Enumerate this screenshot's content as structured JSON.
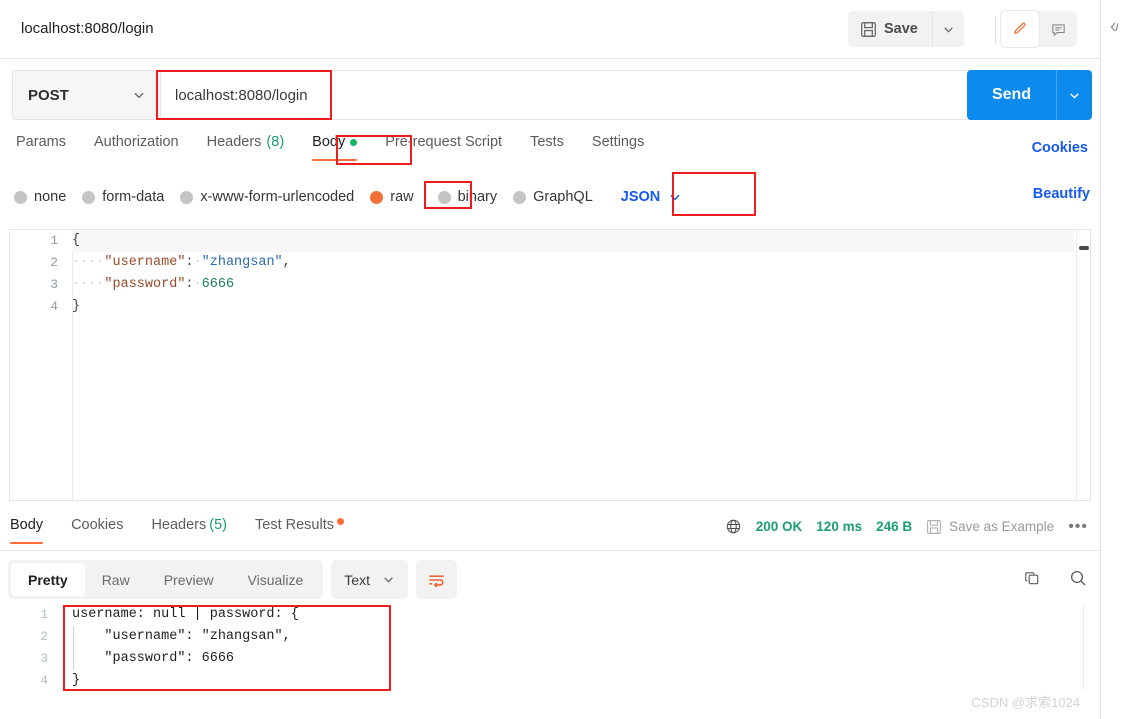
{
  "header": {
    "request_title": "localhost:8080/login",
    "save_label": "Save",
    "save_icon": "floppy-disk-icon",
    "save_caret_icon": "chevron-down-icon",
    "edit_icon": "pencil-icon",
    "comment_icon": "comment-icon",
    "rail_collapse_icon": "chevron-left-icon"
  },
  "url_row": {
    "method": "POST",
    "method_caret_icon": "chevron-down-icon",
    "url": "localhost:8080/login",
    "send_label": "Send",
    "send_caret_icon": "chevron-down-icon"
  },
  "request_tabs": [
    {
      "label": "Params",
      "active": false
    },
    {
      "label": "Authorization",
      "active": false
    },
    {
      "label": "Headers",
      "count": "(8)",
      "active": false
    },
    {
      "label": "Body",
      "active": true,
      "badge": "green-dot"
    },
    {
      "label": "Pre-request Script",
      "active": false
    },
    {
      "label": "Tests",
      "active": false
    },
    {
      "label": "Settings",
      "active": false
    }
  ],
  "links": {
    "cookies": "Cookies",
    "beautify": "Beautify"
  },
  "body_types": [
    {
      "label": "none",
      "selected": false
    },
    {
      "label": "form-data",
      "selected": false
    },
    {
      "label": "x-www-form-urlencoded",
      "selected": false
    },
    {
      "label": "raw",
      "selected": true
    },
    {
      "label": "binary",
      "selected": false
    },
    {
      "label": "GraphQL",
      "selected": false
    }
  ],
  "body_format": {
    "value": "JSON",
    "caret_icon": "chevron-down-icon"
  },
  "request_body": {
    "line_numbers": [
      "1",
      "2",
      "3",
      "4"
    ],
    "lines": [
      {
        "indent": "",
        "text": "{"
      },
      {
        "indent": "····",
        "key": "\"username\"",
        "colon": ":",
        "space": "·",
        "value": "\"zhangsan\"",
        "value_type": "string",
        "trail": ","
      },
      {
        "indent": "····",
        "key": "\"password\"",
        "colon": ":",
        "space": "·",
        "value": "6666",
        "value_type": "number",
        "trail": ""
      },
      {
        "indent": "",
        "text": "}"
      }
    ]
  },
  "response_tabs": [
    {
      "label": "Body",
      "active": true
    },
    {
      "label": "Cookies",
      "active": false
    },
    {
      "label": "Headers",
      "count": "(5)",
      "active": false
    },
    {
      "label": "Test Results",
      "active": false,
      "badge": "orange-dot"
    }
  ],
  "response_status": {
    "globe_icon": "globe-icon",
    "status": "200 OK",
    "time": "120 ms",
    "size": "246 B",
    "save_example_icon": "floppy-disk-icon",
    "save_example_label": "Save as Example",
    "more_icon": "ellipsis-icon"
  },
  "response_view": {
    "modes": [
      {
        "label": "Pretty",
        "active": true
      },
      {
        "label": "Raw",
        "active": false
      },
      {
        "label": "Preview",
        "active": false
      },
      {
        "label": "Visualize",
        "active": false
      }
    ],
    "type": "Text",
    "type_caret_icon": "chevron-down-icon",
    "wrap_icon": "word-wrap-icon",
    "copy_icon": "copy-icon",
    "search_icon": "search-icon"
  },
  "response_body": {
    "line_numbers": [
      "1",
      "2",
      "3",
      "4"
    ],
    "lines": [
      "username: null | password: {",
      "    \"username\": \"zhangsan\",",
      "    \"password\": 6666",
      "}"
    ]
  },
  "watermark": "CSDN @求索1024",
  "colors": {
    "accent_orange": "#ff6c37",
    "send_blue": "#0d8aee",
    "link_blue": "#1559ed",
    "status_green": "#1a9f6f",
    "annotation_red": "#ef1c1c"
  }
}
